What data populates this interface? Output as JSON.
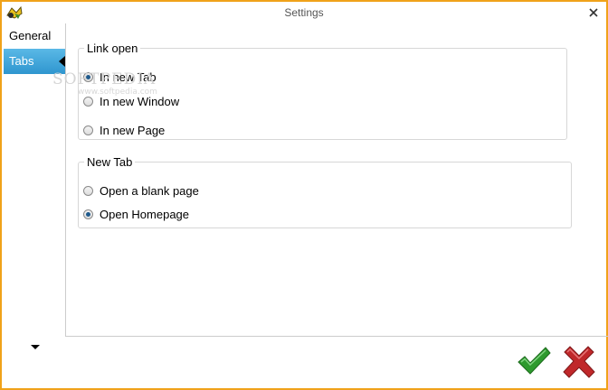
{
  "window": {
    "title": "Settings",
    "border_color": "#f0a21a"
  },
  "sidebar": {
    "items": [
      {
        "label": "General",
        "active": false
      },
      {
        "label": "Tabs",
        "active": true
      }
    ],
    "active_color": "#3aa3da"
  },
  "link_open": {
    "legend": "Link open",
    "options": [
      {
        "label": "In new Tab",
        "checked": true
      },
      {
        "label": "In new Window",
        "checked": false
      },
      {
        "label": "In new Page",
        "checked": false
      }
    ]
  },
  "new_tab": {
    "legend": "New Tab",
    "options": [
      {
        "label": "Open a blank page",
        "checked": false
      },
      {
        "label": "Open Homepage",
        "checked": true
      }
    ]
  },
  "watermark": {
    "text": "SOFTPEDIA",
    "sub": "www.softpedia.com"
  },
  "actions": {
    "ok_icon": "green-check-icon",
    "cancel_icon": "red-x-icon",
    "ok_color": "#2e9a2e",
    "cancel_color": "#c0282a"
  }
}
